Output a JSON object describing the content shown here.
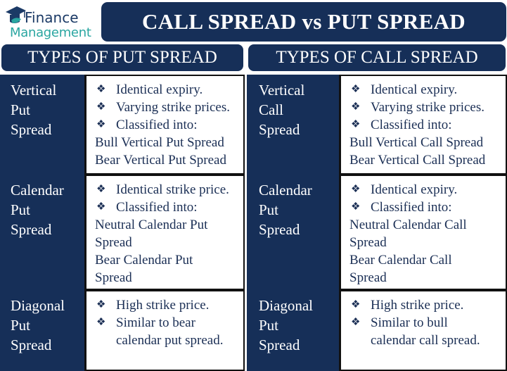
{
  "logo": {
    "line1": "Finance",
    "line2": "Management",
    "icon": "graduation-cap-e-icon"
  },
  "title": "CALL SPREAD vs PUT SPREAD",
  "colors": {
    "navy": "#162f58",
    "teal": "#2aa6a1",
    "text": "#1b2f55"
  },
  "bullet_glyph": "❖",
  "put": {
    "heading": "TYPES OF PUT SPREAD",
    "rows": [
      {
        "label": [
          "Vertical",
          "Put",
          "Spread"
        ],
        "bullets": [
          "Identical expiry.",
          "Varying strike prices.",
          "Classified into:"
        ],
        "lines": [
          "Bull Vertical Put Spread",
          "Bear Vertical Put Spread"
        ]
      },
      {
        "label": [
          "Calendar",
          "Put",
          "Spread"
        ],
        "bullets": [
          "Identical strike price.",
          "Classified into:"
        ],
        "lines": [
          "Neutral Calendar Put",
          "Spread",
          "Bear Calendar Put",
          "Spread"
        ]
      },
      {
        "label": [
          "Diagonal",
          "Put",
          "Spread"
        ],
        "bullets": [
          "High strike price.",
          "Similar to bear"
        ],
        "continuation": "calendar put spread."
      }
    ]
  },
  "call": {
    "heading": "TYPES OF CALL SPREAD",
    "rows": [
      {
        "label": [
          "Vertical",
          "Call",
          "Spread"
        ],
        "bullets": [
          "Identical expiry.",
          "Varying strike prices.",
          "Classified into:"
        ],
        "lines": [
          "Bull Vertical Call Spread",
          "Bear Vertical Call Spread"
        ]
      },
      {
        "label": [
          "Calendar",
          "Put",
          "Spread"
        ],
        "bullets": [
          "Identical expiry.",
          "Classified into:"
        ],
        "lines": [
          "Neutral Calendar Call",
          "Spread",
          "Bear Calendar Call",
          "Spread"
        ]
      },
      {
        "label": [
          "Diagonal",
          "Put",
          "Spread"
        ],
        "bullets": [
          "High strike price.",
          "Similar to bull"
        ],
        "continuation": "calendar call spread."
      }
    ]
  }
}
